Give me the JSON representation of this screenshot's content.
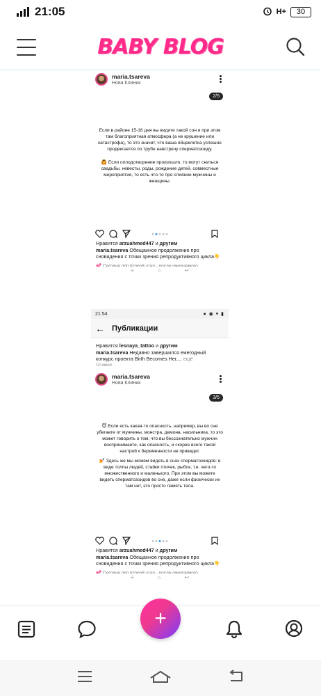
{
  "status_bar": {
    "time": "21:05",
    "network": "H+",
    "battery": "30"
  },
  "header": {
    "logo": "BABY BLOG"
  },
  "screenshot_1": {
    "username": "maria.tsareva",
    "location": "Нова Клиник",
    "counter": "2/5",
    "paragraph_1": "Если в районе 15-16 дня вы видите такой сон и при этом там благоприятная атмосфера (а не крушение или катастрофа), то это значит, что ваша яйцеклетка успешно продвигается по трубе навстречу сперматозоиду.",
    "paragraph_2": "🙆 Если оплодотворение произошло, то могут сниться свадьбы, невесты, роды, рождение детей, совместные мероприятия, то есть что-то про слияние мужчины и женщины.",
    "likes_prefix": "Нравится ",
    "likes_user": "arzuahmed447",
    "likes_middle": " и ",
    "likes_others": "другим",
    "caption_user": "maria.tsareva",
    "caption_text": " Обещанное продолжение про сновидения с точки зрения репродуктивного цикла👇",
    "cut_line": "💕 Сегодня про второй этап - после ожидаемого"
  },
  "screenshot_2": {
    "status_time": "21:54",
    "page_title": "Публикации",
    "prev_likes_prefix": "Нравится ",
    "prev_likes_user": "lesnaya_tattoo",
    "prev_likes_middle": " и ",
    "prev_likes_others": "другим",
    "prev_caption_user": "maria.tsareva",
    "prev_caption_text": " Недавно завершился ежегодный конкурс проекта Birth Becomes Her,...",
    "prev_more": " ещё",
    "prev_date": "10 июня",
    "username": "maria.tsareva",
    "location": "Нова Клиник",
    "counter": "3/5",
    "paragraph_1": "😈 Если есть какая-то опасность, например, вы во сне убегаете от мужчины, монстра, демона, насильника, то это может говорить о том, что вы бессознательно мужчин воспринимаете, как опасность, и скорее всего такой настрой к беременности не приведет.",
    "paragraph_2": "💅 Здесь же мы можем видеть в снах сперматозоидов: в виде толпы людей, стайки птичек, рыбок, т.е. чего-то множественного и маленького. При этом вы можете видеть сперматозоидов во сне, даже если физически их там нет, это просто память тела.",
    "likes_prefix": "Нравится ",
    "likes_user": "arzuahmed447",
    "likes_middle": " и ",
    "likes_others": "другим",
    "caption_user": "maria.tsareva",
    "caption_text": " Обещанное продолжение про сновидения с точки зрения репродуктивного цикла👇",
    "cut_line": "💕 Сегодня про второй этап - после ожидаемого"
  },
  "bottom_nav": {
    "fab_label": "+",
    "icons": [
      "feed-icon",
      "chat-icon",
      "bell-icon",
      "profile-icon"
    ]
  },
  "colors": {
    "brand": "#ff2b8a",
    "fab_start": "#ff2fa0",
    "fab_end": "#7a3cff",
    "carousel_active": "#3897f0"
  }
}
